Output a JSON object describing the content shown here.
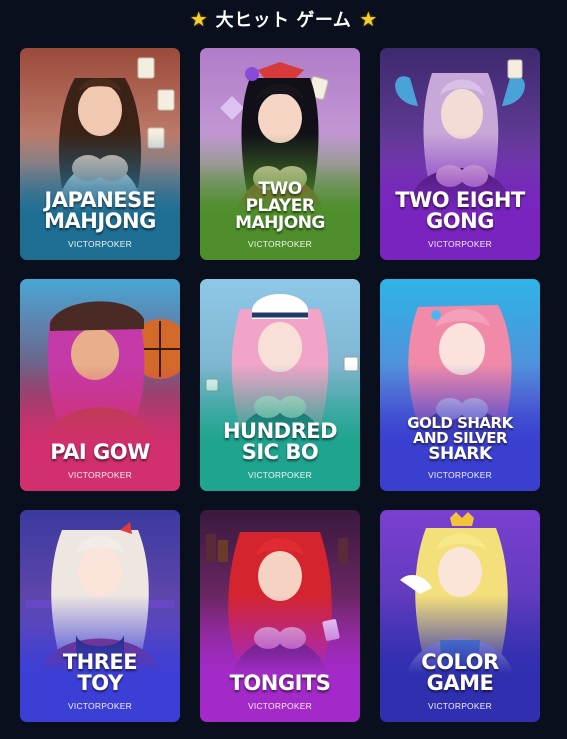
{
  "header": {
    "title": "大ヒット ゲーム",
    "left_icon": "star-icon",
    "right_icon": "star-icon",
    "star_color": "#f7d12b"
  },
  "games": [
    {
      "title_lines": [
        "JAPANESE",
        "MAHJONG"
      ],
      "provider": "VICTORPOKER",
      "colors": {
        "top": "#9b4a3a",
        "mid": "#c88a7a",
        "bottom": "#1f6f95"
      }
    },
    {
      "title_lines": [
        "TWO",
        "PLAYER",
        "MAHJONG"
      ],
      "provider": "VICTORPOKER",
      "colors": {
        "top": "#b07cc8",
        "mid": "#c9a0d8",
        "bottom": "#4e8f2b"
      }
    },
    {
      "title_lines": [
        "TWO EIGHT",
        "GONG"
      ],
      "provider": "VICTORPOKER",
      "colors": {
        "top": "#3d2a6e",
        "mid": "#6a3fa0",
        "bottom": "#7a24c0"
      }
    },
    {
      "title_lines": [
        "PAI GOW"
      ],
      "provider": "VICTORPOKER",
      "colors": {
        "top": "#4aa7d6",
        "mid": "#7a4c6e",
        "bottom": "#d12f6e"
      }
    },
    {
      "title_lines": [
        "HUNDRED",
        "SIC BO"
      ],
      "provider": "VICTORPOKER",
      "colors": {
        "top": "#8fc7e8",
        "mid": "#7ab0c8",
        "bottom": "#1fa58f"
      }
    },
    {
      "title_lines": [
        "GOLD SHARK",
        "AND SILVER",
        "SHARK"
      ],
      "provider": "VICTORPOKER",
      "colors": {
        "top": "#2fb4e6",
        "mid": "#5a86d8",
        "bottom": "#3a3fd0"
      }
    },
    {
      "title_lines": [
        "THREE",
        "TOY"
      ],
      "provider": "VICTORPOKER",
      "colors": {
        "top": "#3b3a9e",
        "mid": "#6a4ab0",
        "bottom": "#3c3fd6"
      }
    },
    {
      "title_lines": [
        "TONGITS"
      ],
      "provider": "VICTORPOKER",
      "colors": {
        "top": "#3a1a3e",
        "mid": "#7a2a6e",
        "bottom": "#a32ac8"
      }
    },
    {
      "title_lines": [
        "COLOR",
        "GAME"
      ],
      "provider": "VICTORPOKER",
      "colors": {
        "top": "#7a3fd0",
        "mid": "#5a3ab8",
        "bottom": "#2f2fb0"
      }
    }
  ]
}
